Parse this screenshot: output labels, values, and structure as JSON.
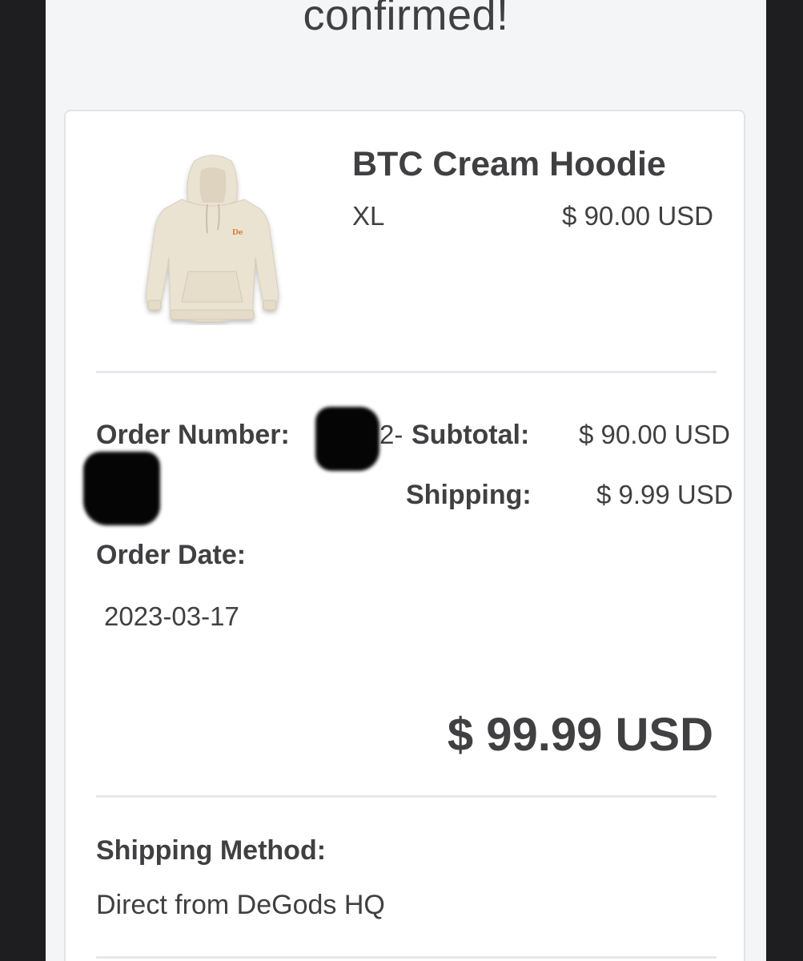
{
  "header": {
    "title": "confirmed!"
  },
  "product": {
    "name": "BTC Cream Hoodie",
    "size": "XL",
    "price": "$ 90.00 USD",
    "image_icon": "hoodie-image",
    "colors": {
      "hoodie": "#ebe3d2",
      "logo": "#e07b2a"
    }
  },
  "order": {
    "number_label": "Order Number:",
    "number_visible_fragment": "2-",
    "date_label": "Order Date:",
    "date_value": "2023-03-17"
  },
  "totals": {
    "subtotal_label": "Subtotal:",
    "subtotal_value": "$ 90.00 USD",
    "shipping_label": "Shipping:",
    "shipping_value": "$ 9.99 USD",
    "total": "$ 99.99 USD"
  },
  "shipping": {
    "method_label": "Shipping Method:",
    "method_value": "Direct from DeGods HQ"
  }
}
